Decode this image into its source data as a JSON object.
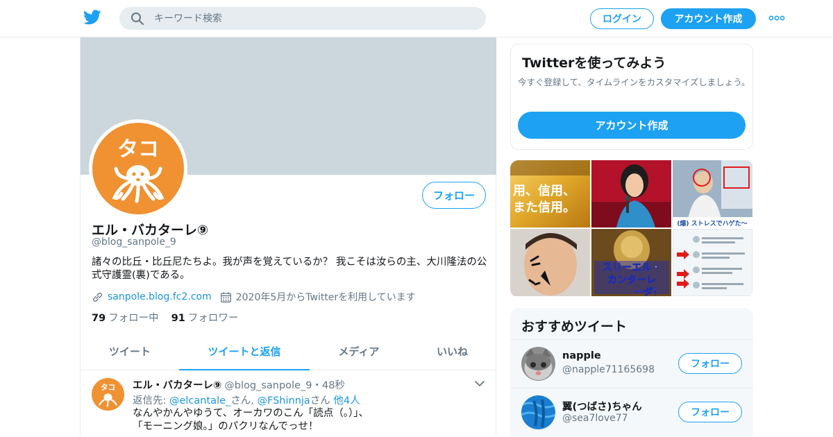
{
  "topbar": {
    "logo_icon": "twitter-bird-icon",
    "search_placeholder": "キーワード検索",
    "login_label": "ログイン",
    "signup_label": "アカウント作成",
    "more_icon": "more-dots-icon"
  },
  "colors": {
    "accent": "#1da1f2",
    "banner": "#ccd6dd",
    "avatar_orange": "#f09132",
    "text_secondary": "#657786"
  },
  "profile": {
    "follow_label": "フォロー",
    "avatar_text": "タコ",
    "name": "エル・バカターレ⑨",
    "handle": "@blog_sanpole_9",
    "bio": "諸々の比丘・比丘尼たちよ。我が声を覚えているか？ 我こそは汝らの主、大川隆法の公式守護霊(裏)である。",
    "website": "sanpole.blog.fc2.com",
    "joined": "2020年5月からTwitterを利用しています",
    "following_count": "79",
    "following_label": "フォロー中",
    "followers_count": "91",
    "followers_label": "フォロワー"
  },
  "tabs": [
    {
      "label": "ツイート"
    },
    {
      "label": "ツイートと返信"
    },
    {
      "label": "メディア"
    },
    {
      "label": "いいね"
    }
  ],
  "active_tab": "ツイートと返信",
  "tweet": {
    "name": "エル・バカターレ⑨",
    "handle": "@blog_sanpole_9",
    "separator": "・",
    "time": "48秒",
    "reply_prefix": "返信先: ",
    "mention1": "@elcantale_",
    "san1": "さん, ",
    "mention2": "@FShinnja",
    "san2": "さん ",
    "others": "他4人",
    "line1": "なんやかんやゆうて、オーカワのこん「読点（。）」、",
    "line2": "「モーニング娘。」のパクリなんでっせ！"
  },
  "signup_card": {
    "title": "Twitterを使ってみよう",
    "desc": "今すぐ登録して、タイムラインをカスタマイズしましょう。",
    "cta": "アカウント作成"
  },
  "media": {
    "tile1_lines": [
      "用、信用、",
      "また信用。"
    ],
    "tile3_caption": "(爆) ストレスでハゲた〜",
    "tile5_lines": [
      "スリーエル・",
      "カンターレ",
      "ーダ！"
    ]
  },
  "recommended": {
    "title": "おすすめツイート",
    "accounts": [
      {
        "name": "napple",
        "handle": "@napple71165698",
        "follow_label": "フォロー"
      },
      {
        "name": "翼(つばさ)ちゃん",
        "handle": "@sea7love77",
        "follow_label": "フォロー"
      }
    ]
  }
}
